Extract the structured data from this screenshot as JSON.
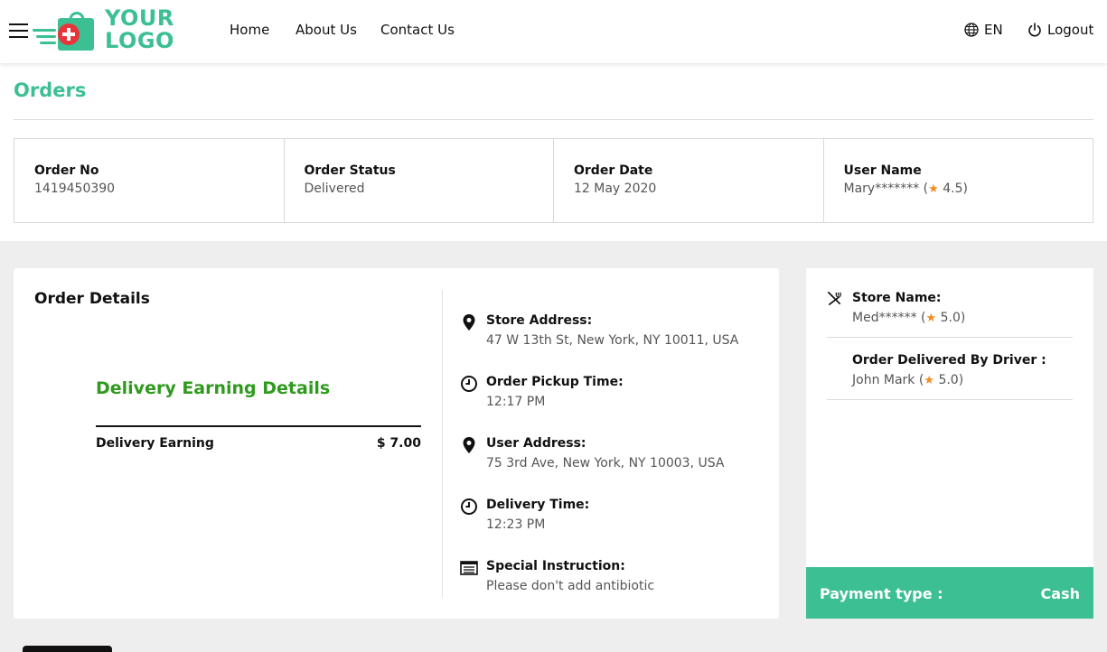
{
  "header": {
    "logo_line1": "YOUR",
    "logo_line2": "LOGO",
    "nav": {
      "home": "Home",
      "about": "About Us",
      "contact": "Contact Us"
    },
    "language": "EN",
    "logout": "Logout"
  },
  "page_title": "Orders",
  "summary": {
    "order_no_label": "Order No",
    "order_no": "1419450390",
    "status_label": "Order Status",
    "status": "Delivered",
    "date_label": "Order Date",
    "date": "12 May 2020",
    "user_label": "User Name",
    "user_name": "Mary*******",
    "user_rating": "4.5"
  },
  "order_details": {
    "title": "Order Details",
    "earning_title": "Delivery Earning Details",
    "earning_label": "Delivery Earning",
    "earning_value": "$ 7.00",
    "store_address_label": "Store Address:",
    "store_address": "47 W 13th St, New York, NY 10011, USA",
    "pickup_time_label": "Order Pickup Time:",
    "pickup_time": "12:17 PM",
    "user_address_label": "User Address:",
    "user_address": "75 3rd Ave, New York, NY 10003, USA",
    "delivery_time_label": "Delivery Time:",
    "delivery_time": "12:23 PM",
    "instruction_label": "Special Instruction:",
    "instruction": "Please don't add antibiotic"
  },
  "side": {
    "store_label": "Store Name:",
    "store_name": "Med******",
    "store_rating": "5.0",
    "driver_label": "Order Delivered By Driver :",
    "driver_name": "John Mark",
    "driver_rating": "5.0",
    "payment_label": "Payment type :",
    "payment_value": "Cash"
  },
  "colors": {
    "accent": "#3dbf94",
    "earning_green": "#2f9a1e",
    "star": "#f28c1b",
    "logo_red": "#e8353b"
  }
}
